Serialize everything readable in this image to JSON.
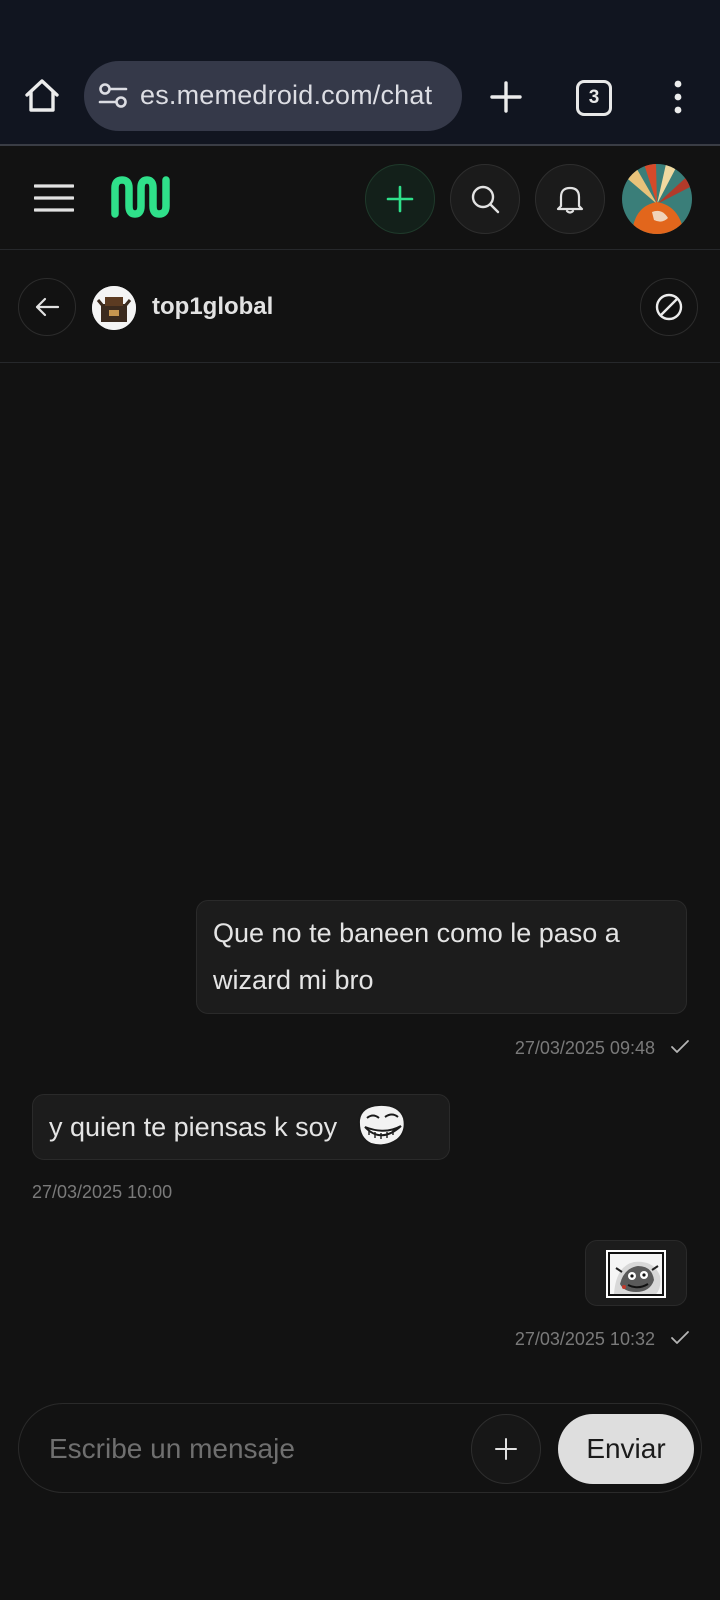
{
  "browser": {
    "url": "es.memedroid.com/chat",
    "tab_count": "3",
    "icons": [
      "home-icon",
      "site-settings-icon",
      "new-tab-icon",
      "tab-switcher-icon",
      "more-vert-icon"
    ]
  },
  "app_header": {
    "icons": [
      "menu-icon",
      "memedroid-logo",
      "plus-icon",
      "search-icon",
      "bell-icon",
      "avatar"
    ],
    "accent_color": "#2fe08a"
  },
  "chat": {
    "contact_name": "top1global",
    "messages": [
      {
        "direction": "outgoing",
        "text": "Que no te baneen como le paso a wizard mi bro",
        "timestamp": "27/03/2025 09:48",
        "read": true
      },
      {
        "direction": "incoming",
        "text": "y quien te piensas k soy",
        "has_emoji_image": "trollface",
        "timestamp": "27/03/2025 10:00"
      },
      {
        "direction": "outgoing",
        "image": "meme-thumbnail",
        "timestamp": "27/03/2025 10:32",
        "read": true
      }
    ]
  },
  "composer": {
    "placeholder": "Escribe un mensaje",
    "send_label": "Enviar"
  }
}
